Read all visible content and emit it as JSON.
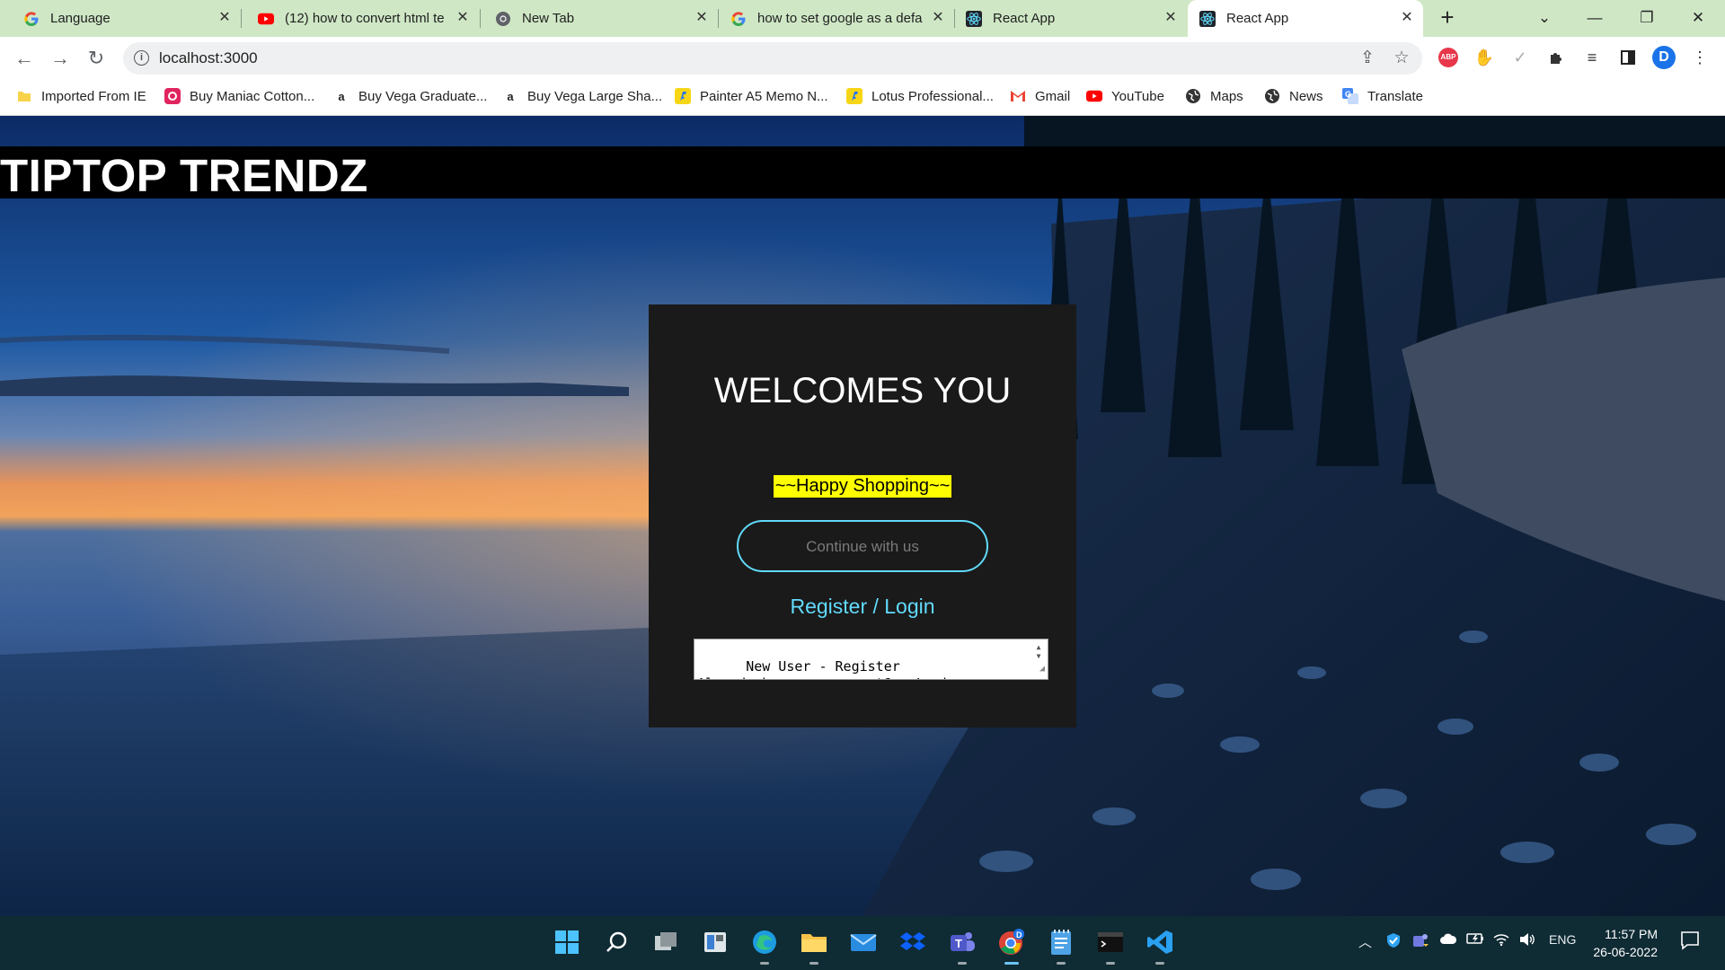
{
  "browser": {
    "tabs": [
      {
        "title": "Language",
        "icon": "google-g-icon"
      },
      {
        "title": "(12) how to convert html te",
        "icon": "youtube-icon"
      },
      {
        "title": "New Tab",
        "icon": "chrome-icon"
      },
      {
        "title": "how to set google as a defa",
        "icon": "google-g-icon"
      },
      {
        "title": "React App",
        "icon": "react-icon"
      },
      {
        "title": "React App",
        "icon": "react-icon",
        "active": true
      }
    ],
    "url": "localhost:3000",
    "profile_initial": "D",
    "abp_label": "ABP",
    "bookmarks": [
      {
        "label": "Imported From IE",
        "icon": "folder-icon"
      },
      {
        "label": "Buy Maniac Cotton...",
        "icon": "maniac-icon"
      },
      {
        "label": "Buy Vega Graduate...",
        "icon": "amazon-icon"
      },
      {
        "label": "Buy Vega Large Sha...",
        "icon": "amazon-icon"
      },
      {
        "label": "Painter A5 Memo N...",
        "icon": "flipkart-icon"
      },
      {
        "label": "Lotus Professional...",
        "icon": "flipkart-icon"
      },
      {
        "label": "Gmail",
        "icon": "gmail-icon"
      },
      {
        "label": "YouTube",
        "icon": "youtube-icon"
      },
      {
        "label": "Maps",
        "icon": "globe-icon"
      },
      {
        "label": "News",
        "icon": "globe-icon"
      },
      {
        "label": "Translate",
        "icon": "translate-icon"
      }
    ]
  },
  "page": {
    "brand": "TIPTOP TRENDZ",
    "card": {
      "title": "WELCOMES YOU",
      "tagline": "~~Happy Shopping~~",
      "continue_label": "Continue with us",
      "register_label": "Register / Login",
      "textarea_value": "New User - Register\nAlready have an account? - Login"
    }
  },
  "taskbar": {
    "lang": "ENG",
    "time": "11:57 PM",
    "date": "26-06-2022"
  },
  "colors": {
    "tabstrip": "#cfe7c5",
    "accent_cyan": "#61dafb",
    "tagline_bg": "#ffff00",
    "card_bg": "#1a1a1a"
  }
}
